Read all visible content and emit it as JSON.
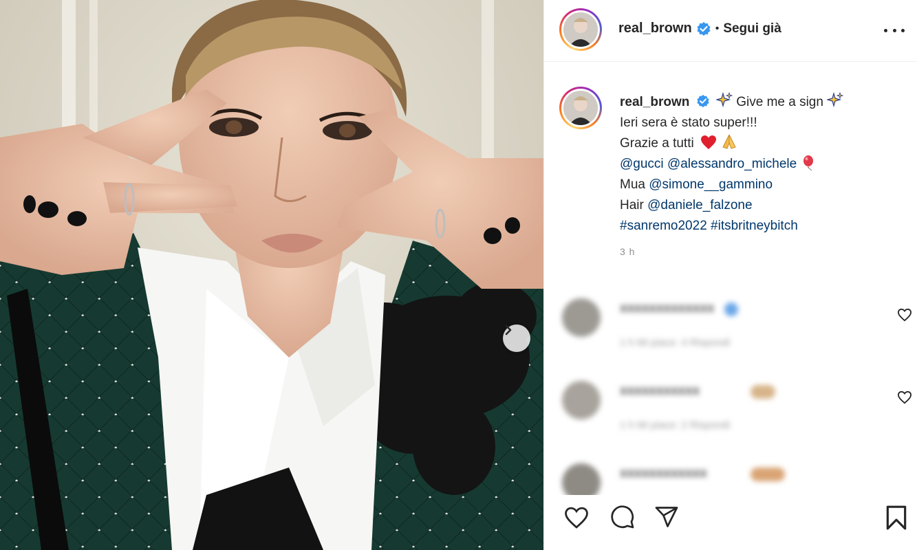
{
  "post": {
    "image_alt": "Woman with slicked-back blonde hair making V signs over her eyes, wearing a white shirt and dark green studded velvet jacket"
  },
  "header": {
    "username": "real_brown",
    "separator": "•",
    "follow_label": "Segui già"
  },
  "caption": {
    "username": "real_brown",
    "line1_text": "Give me a sign",
    "line2": "Ieri sera è stato super!!!",
    "line3": "Grazie a tutti",
    "mentions1": [
      "@gucci",
      "@alessandro_michele"
    ],
    "mua_label": "Mua",
    "mua_handle": "@simone__gammino",
    "hair_label": "Hair",
    "hair_handle": "@daniele_falzone",
    "hashtags": [
      "#sanremo2022",
      "#itsbritneybitch"
    ],
    "timestamp": "3 h"
  },
  "comments": [
    {
      "user": "xxxxxxxxxxxxx",
      "meta": "1 h  Mi piace: 4  Rispondi"
    },
    {
      "user": "xxxxxxxxxxx",
      "meta": "1 h  Mi piace: 2  Rispondi"
    },
    {
      "user": "xxxxxxxxxxxx",
      "meta": ""
    }
  ],
  "colors": {
    "verified": "#3897f0",
    "link": "#00376b",
    "text": "#262626",
    "muted": "#8e8e8e"
  }
}
